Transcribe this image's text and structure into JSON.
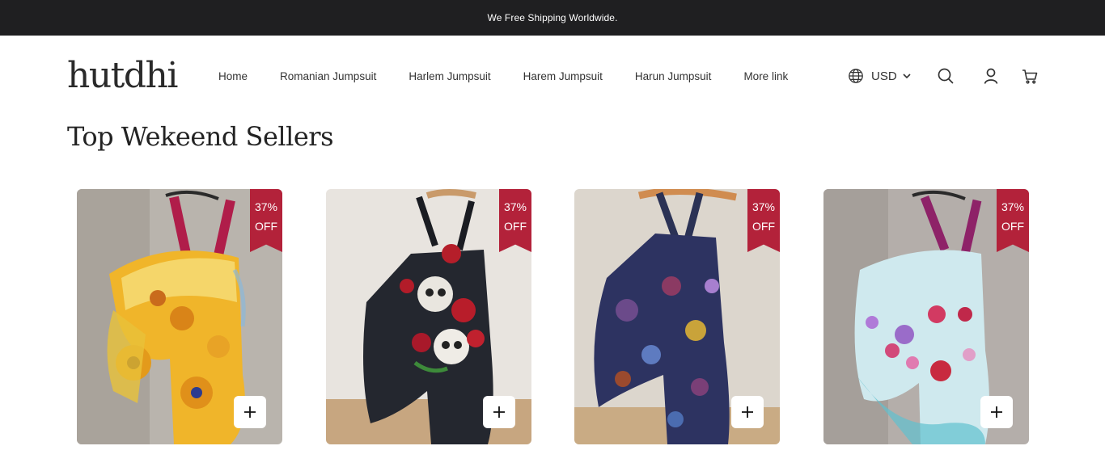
{
  "announcement": "We Free Shipping Worldwide.",
  "brand": {
    "logo": "hutdhi"
  },
  "nav": [
    "Home",
    "Romanian Jumpsuit",
    "Harlem Jumpsuit",
    "Harem Jumpsuit",
    "Harun Jumpsuit",
    "More link"
  ],
  "currency": {
    "code": "USD",
    "icon": "globe-icon"
  },
  "header_icons": [
    "search-icon",
    "account-icon",
    "cart-icon"
  ],
  "section_title": "Top Wekeend Sellers",
  "products": [
    {
      "discount_pct": "37%",
      "discount_word": "OFF",
      "image": "sunflower-jumpsuit-image",
      "add_icon": "plus-icon"
    },
    {
      "discount_pct": "37%",
      "discount_word": "OFF",
      "image": "skull-rose-jumpsuit-image",
      "add_icon": "plus-icon"
    },
    {
      "discount_pct": "37%",
      "discount_word": "OFF",
      "image": "dark-floral-jumpsuit-image",
      "add_icon": "plus-icon"
    },
    {
      "discount_pct": "37%",
      "discount_word": "OFF",
      "image": "pastel-floral-jumpsuit-image",
      "add_icon": "plus-icon"
    }
  ],
  "colors": {
    "announcement_bg": "#1f1f21",
    "ribbon": "#b3223a",
    "text": "#222222"
  }
}
